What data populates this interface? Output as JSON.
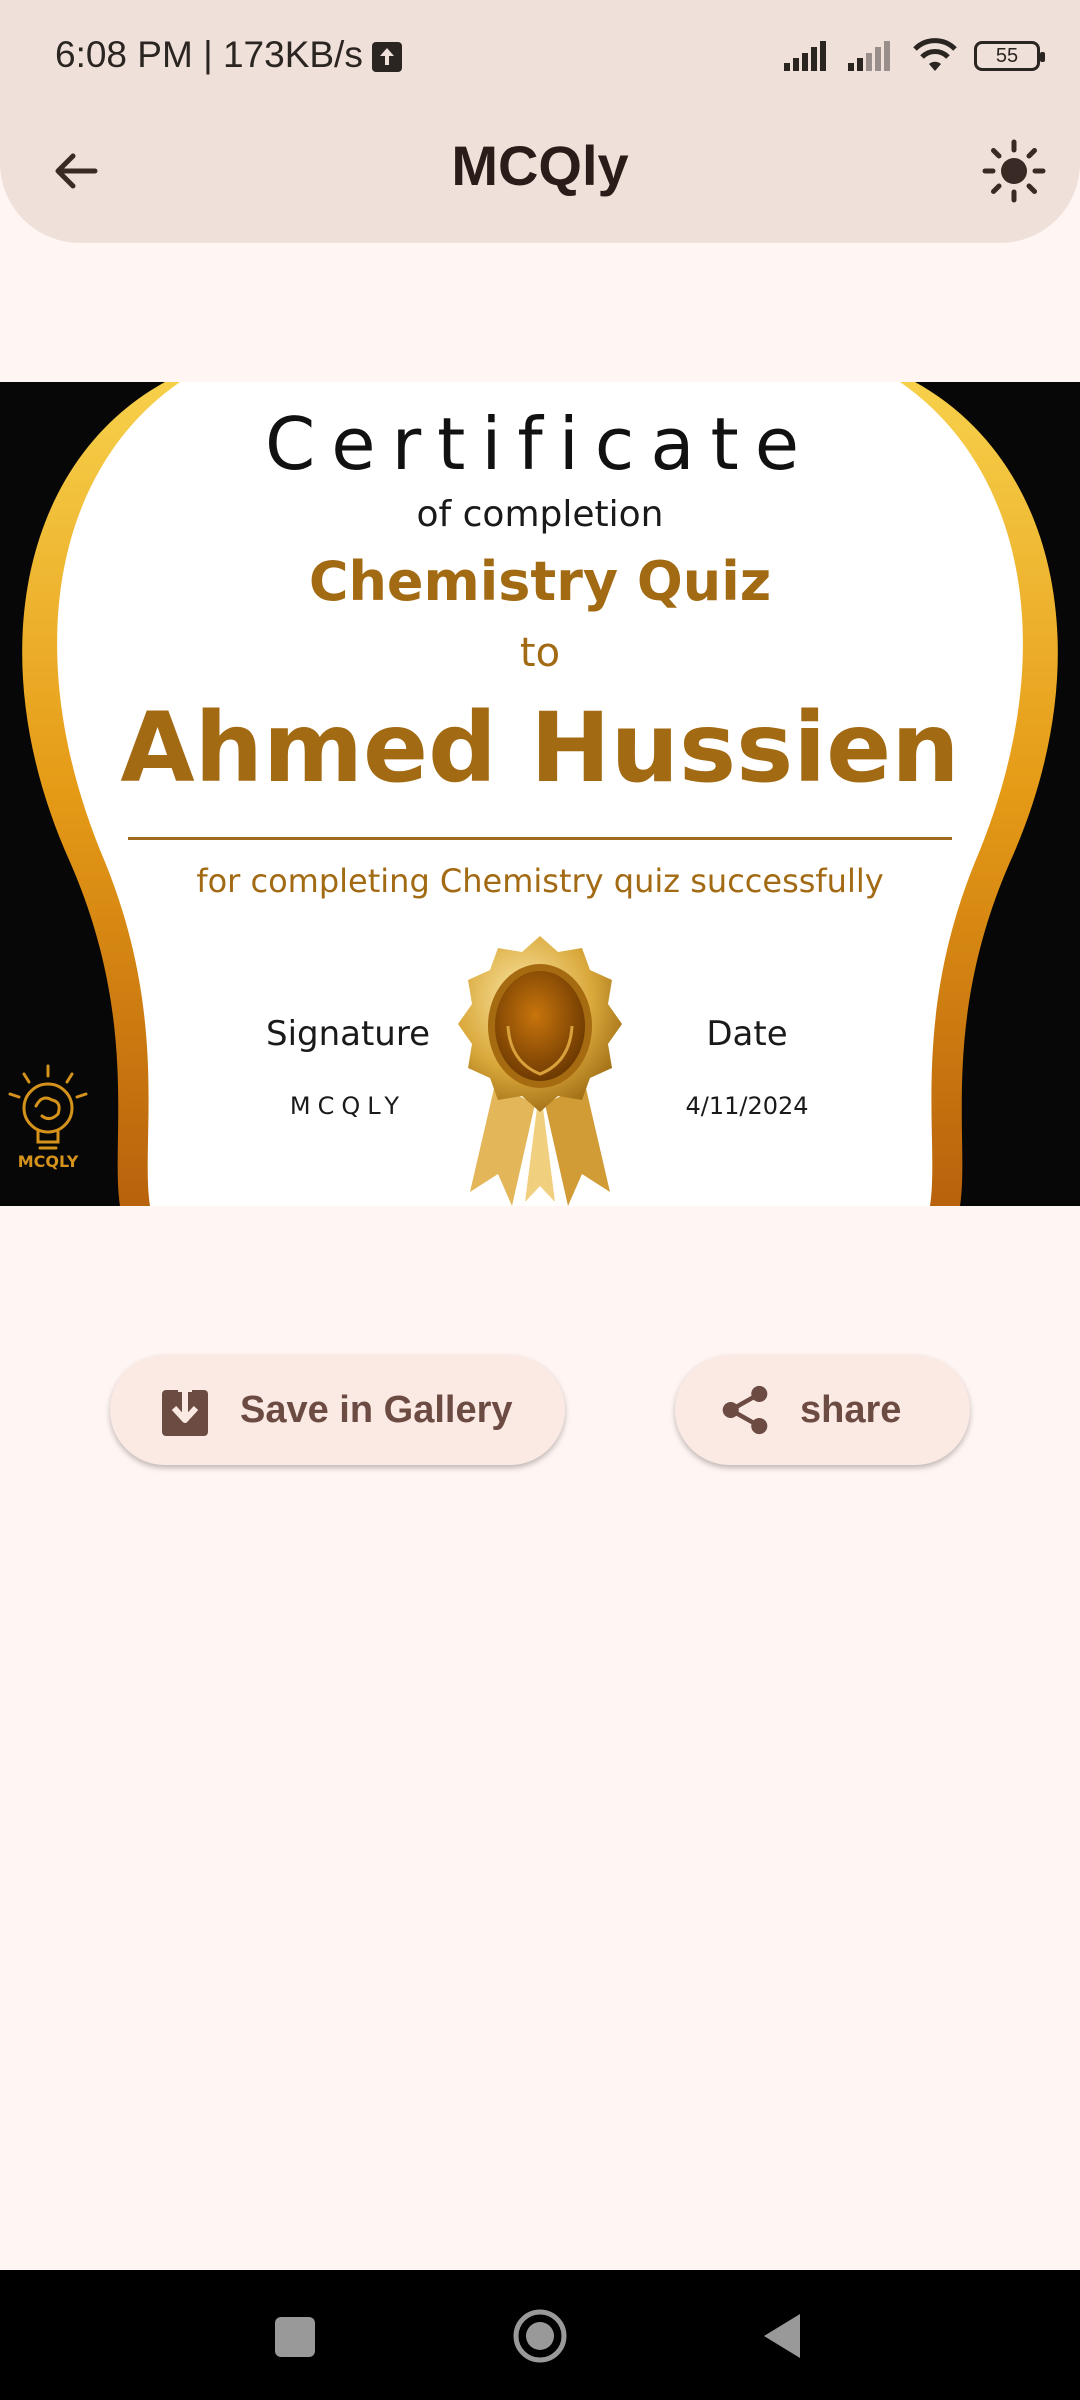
{
  "status_bar": {
    "time": "6:08 PM | 173KB/s",
    "battery": "55"
  },
  "app_bar": {
    "title": "MCQly"
  },
  "certificate": {
    "title": "Certificate",
    "subtitle": "of completion",
    "quiz_name": "Chemistry Quiz",
    "to": "to",
    "recipient": "Ahmed Hussien",
    "description": "for completing Chemistry quiz successfully",
    "signature_label": "Signature",
    "signature_value": "MCQLY",
    "date_label": "Date",
    "date_value": "4/11/2024",
    "logo_text": "MCQLY",
    "colors": {
      "accent": "#a36a14",
      "border_gold": "#e0a21c",
      "background": "#000000"
    }
  },
  "actions": {
    "save_label": "Save in Gallery",
    "share_label": "share"
  },
  "icons": {
    "back": "arrow-back-icon",
    "theme": "sun-icon",
    "save": "download-icon",
    "share": "share-icon"
  },
  "colors": {
    "page_background": "#fff5f2",
    "top_panel": "#f0e0da",
    "button_background": "#fbe9e4",
    "button_text": "#6b4b42"
  }
}
